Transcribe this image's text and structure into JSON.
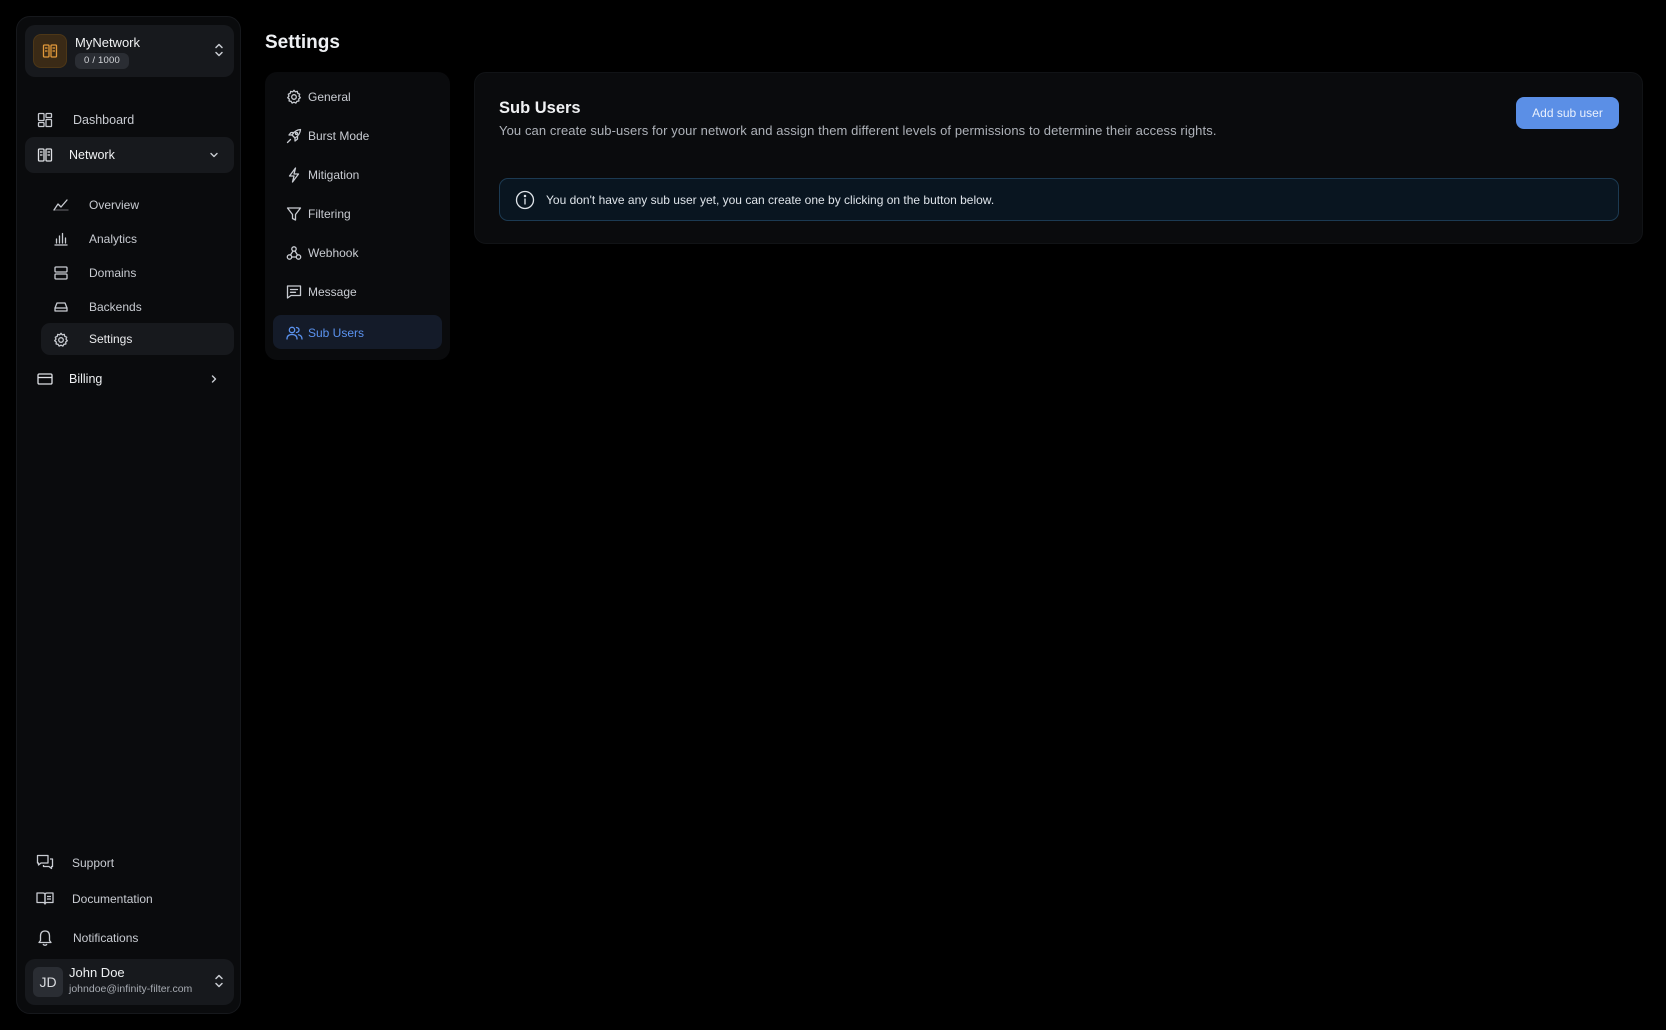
{
  "sidebar": {
    "network_switcher": {
      "name": "MyNetwork",
      "quota": "0 / 1000",
      "logo_icon": "network-grid-icon",
      "accent_color": "#e0983a"
    },
    "nav": {
      "dashboard": "Dashboard",
      "network": "Network",
      "billing": "Billing"
    },
    "network_subnav": {
      "overview": "Overview",
      "analytics": "Analytics",
      "domains": "Domains",
      "backends": "Backends",
      "settings": "Settings"
    },
    "footer": {
      "support": "Support",
      "documentation": "Documentation",
      "notifications": "Notifications"
    },
    "user": {
      "initials": "JD",
      "name": "John Doe",
      "email": "johndoe@infinity-filter.com"
    }
  },
  "page": {
    "title": "Settings"
  },
  "settings_nav": {
    "general": "General",
    "burst_mode": "Burst Mode",
    "mitigation": "Mitigation",
    "filtering": "Filtering",
    "webhook": "Webhook",
    "message": "Message",
    "sub_users": "Sub Users",
    "active": "Sub Users"
  },
  "sub_users_panel": {
    "title": "Sub Users",
    "description": "You can create sub-users for your network and assign them different levels of permissions to determine their access rights.",
    "add_button": "Add sub user",
    "empty_alert": "You don't have any sub user yet, you can create one by clicking on the button below."
  },
  "colors": {
    "background": "#000000",
    "panel": "#0a0b0d",
    "primary": "#5b8fe6",
    "active_nav_text": "#5b93f0",
    "info_border": "#1c3a52"
  }
}
